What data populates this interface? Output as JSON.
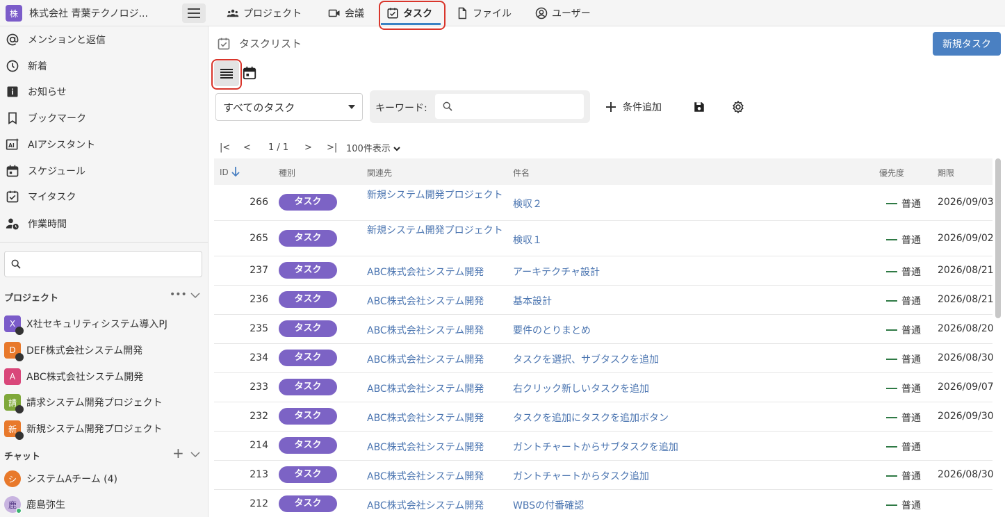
{
  "org": {
    "badge": "株",
    "name": "株式会社 青葉テクノロジ..."
  },
  "nav": {
    "projects": "プロジェクト",
    "meetings": "会議",
    "tasks": "タスク",
    "files": "ファイル",
    "users": "ユーザー"
  },
  "sidebar": {
    "items": [
      {
        "label": "メンションと返信",
        "icon": "at-icon"
      },
      {
        "label": "新着",
        "icon": "clock-icon"
      },
      {
        "label": "お知らせ",
        "icon": "info-icon"
      },
      {
        "label": "ブックマーク",
        "icon": "bookmark-icon"
      },
      {
        "label": "AIアシスタント",
        "icon": "ai-icon"
      },
      {
        "label": "スケジュール",
        "icon": "calendar-icon"
      },
      {
        "label": "マイタスク",
        "icon": "task-check-icon"
      },
      {
        "label": "作業時間",
        "icon": "person-clock-icon"
      }
    ],
    "projects_heading": "プロジェクト",
    "projects_more": "•••",
    "projects": [
      {
        "badge": "X",
        "color": "#7b5cc9",
        "label": "X社セキュリティシステム導入PJ",
        "locked": true
      },
      {
        "badge": "D",
        "color": "#e8792b",
        "label": "DEF株式会社システム開発",
        "locked": true
      },
      {
        "badge": "A",
        "color": "#d9477a",
        "label": "ABC株式会社システム開発",
        "locked": false
      },
      {
        "badge": "請",
        "color": "#7fa83a",
        "label": "請求システム開発プロジェクト",
        "locked": true
      },
      {
        "badge": "新",
        "color": "#e8792b",
        "label": "新規システム開発プロジェクト",
        "locked": true
      }
    ],
    "chat_heading": "チャット",
    "chat_add": "+",
    "chats": [
      {
        "badge": "シ",
        "color": "#e8792b",
        "label": "システムAチーム (4)"
      },
      {
        "badge": "鹿",
        "color": "#c8b4e0",
        "label": "鹿島弥生"
      }
    ]
  },
  "main": {
    "title": "タスクリスト",
    "new_button": "新規タスク",
    "filter": "すべてのタスク",
    "keyword_label": "キーワード:",
    "add_condition": "条件追加",
    "pager": {
      "first": "|<",
      "prev": "<",
      "page": "1 / 1",
      "next": ">",
      "last": ">|",
      "per_page": "100件表示"
    },
    "columns": {
      "id": "ID",
      "type": "種別",
      "related": "関連先",
      "subject": "件名",
      "priority": "優先度",
      "due": "期限"
    },
    "rows": [
      {
        "id": "266",
        "type": "タスク",
        "related": "新規システム開発プロジェクト",
        "subject": "検収２",
        "priority": "普通",
        "due": "2026/09/03"
      },
      {
        "id": "265",
        "type": "タスク",
        "related": "新規システム開発プロジェクト",
        "subject": "検収１",
        "priority": "普通",
        "due": "2026/09/02"
      },
      {
        "id": "237",
        "type": "タスク",
        "related": "ABC株式会社システム開発",
        "subject": "アーキテクチャ設計",
        "priority": "普通",
        "due": "2026/08/21"
      },
      {
        "id": "236",
        "type": "タスク",
        "related": "ABC株式会社システム開発",
        "subject": "基本設計",
        "priority": "普通",
        "due": "2026/08/21"
      },
      {
        "id": "235",
        "type": "タスク",
        "related": "ABC株式会社システム開発",
        "subject": "要件のとりまとめ",
        "priority": "普通",
        "due": "2026/08/20"
      },
      {
        "id": "234",
        "type": "タスク",
        "related": "ABC株式会社システム開発",
        "subject": "タスクを選択、サブタスクを追加",
        "priority": "普通",
        "due": "2026/08/30"
      },
      {
        "id": "233",
        "type": "タスク",
        "related": "ABC株式会社システム開発",
        "subject": "右クリック新しいタスクを追加",
        "priority": "普通",
        "due": "2026/09/07"
      },
      {
        "id": "232",
        "type": "タスク",
        "related": "ABC株式会社システム開発",
        "subject": "タスクを追加にタスクを追加ボタン",
        "priority": "普通",
        "due": "2026/09/30"
      },
      {
        "id": "214",
        "type": "タスク",
        "related": "ABC株式会社システム開発",
        "subject": "ガントチャートからサブタスクを追加",
        "priority": "普通",
        "due": ""
      },
      {
        "id": "213",
        "type": "タスク",
        "related": "ABC株式会社システム開発",
        "subject": "ガントチャートからタスク追加",
        "priority": "普通",
        "due": "2026/08/30"
      },
      {
        "id": "212",
        "type": "タスク",
        "related": "ABC株式会社システム開発",
        "subject": "WBSの付番確認",
        "priority": "普通",
        "due": ""
      }
    ]
  },
  "colors": {
    "accent": "#4a80c2",
    "pill": "#7c63c5",
    "link": "#4a74b0",
    "highlight": "#d9352b"
  }
}
